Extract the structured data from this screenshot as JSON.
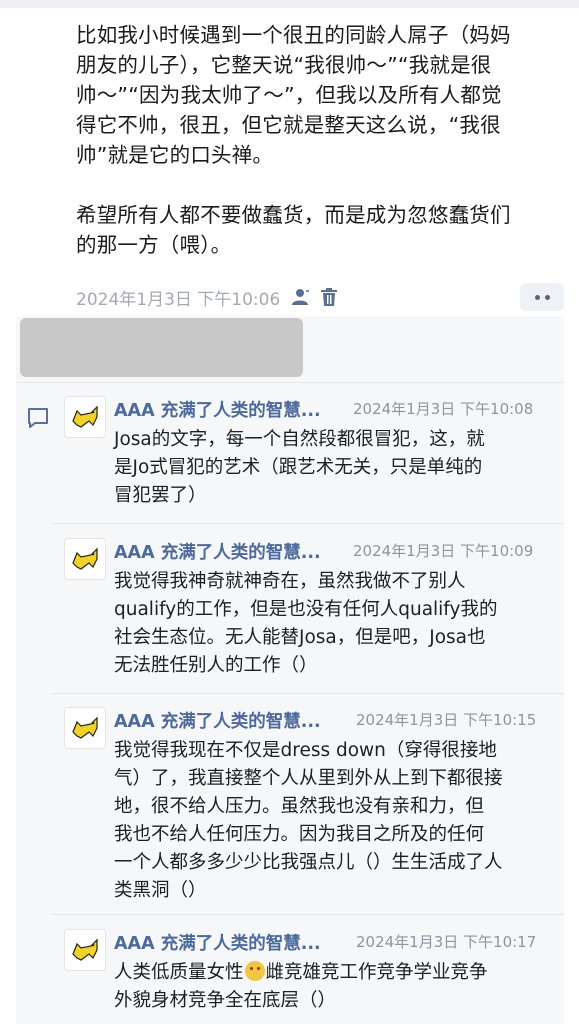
{
  "post": {
    "paragraph1_lines": [
      "比如我小时候遇到一个很丑的同龄人屌子（妈妈",
      "朋友的儿子），它整天说“我很帅～”“我就是很",
      "帅～”“因为我太帅了～”，但我以及所有人都觉",
      "得它不帅，很丑，但它就是整天这么说，“我很",
      "帅”就是它的口头禅。"
    ],
    "paragraph2_lines": [
      "希望所有人都不要做蠢货，而是成为忽悠蠢货们",
      "的那一方（喂）。"
    ],
    "timestamp": "2024年1月3日 下午10:06"
  },
  "icons": {
    "author": "person-icon",
    "delete": "trash-icon",
    "more": "more-dots-icon",
    "comment": "comment-icon",
    "avatar": "yellow-cat-avatar",
    "emoji": "cat-face-emoji"
  },
  "colors": {
    "name": "#4d6a9b",
    "meta": "#a3a9b3",
    "thread_bg": "#f6f7f9",
    "icon": "#5a6f93"
  },
  "comments": [
    {
      "name": "AAA 充满了人类的智慧...",
      "time": "2024年1月3日 下午10:08",
      "lines": [
        "Josa的文字，每一个自然段都很冒犯，这，就",
        "是Jo式冒犯的艺术（跟艺术无关，只是单纯的",
        "冒犯罢了）"
      ]
    },
    {
      "name": "AAA 充满了人类的智慧...",
      "time": "2024年1月3日 下午10:09",
      "lines": [
        "我觉得我神奇就神奇在，虽然我做不了别人",
        "qualify的工作，但是也没有任何人qualify我的",
        "社会生态位。无人能替Josa，但是吧，Josa也",
        "无法胜任别人的工作（）"
      ]
    },
    {
      "name": "AAA 充满了人类的智慧...",
      "time": "2024年1月3日 下午10:15",
      "lines": [
        "我觉得我现在不仅是dress down（穿得很接地",
        "气）了，我直接整个人从里到外从上到下都很接",
        "地，很不给人压力。虽然我也没有亲和力，但",
        "我也不给人任何压力。因为我目之所及的任何",
        "一个人都多多少少比我强点儿（）生生活成了人",
        "类黑洞（）"
      ]
    },
    {
      "name": "AAA 充满了人类的智慧...",
      "time": "2024年1月3日 下午10:17",
      "line1_before": "人类低质量女性",
      "line1_after": "雌竞雄竞工作竞争学业竞争",
      "line2": "外貌身材竞争全在底层（）"
    }
  ]
}
